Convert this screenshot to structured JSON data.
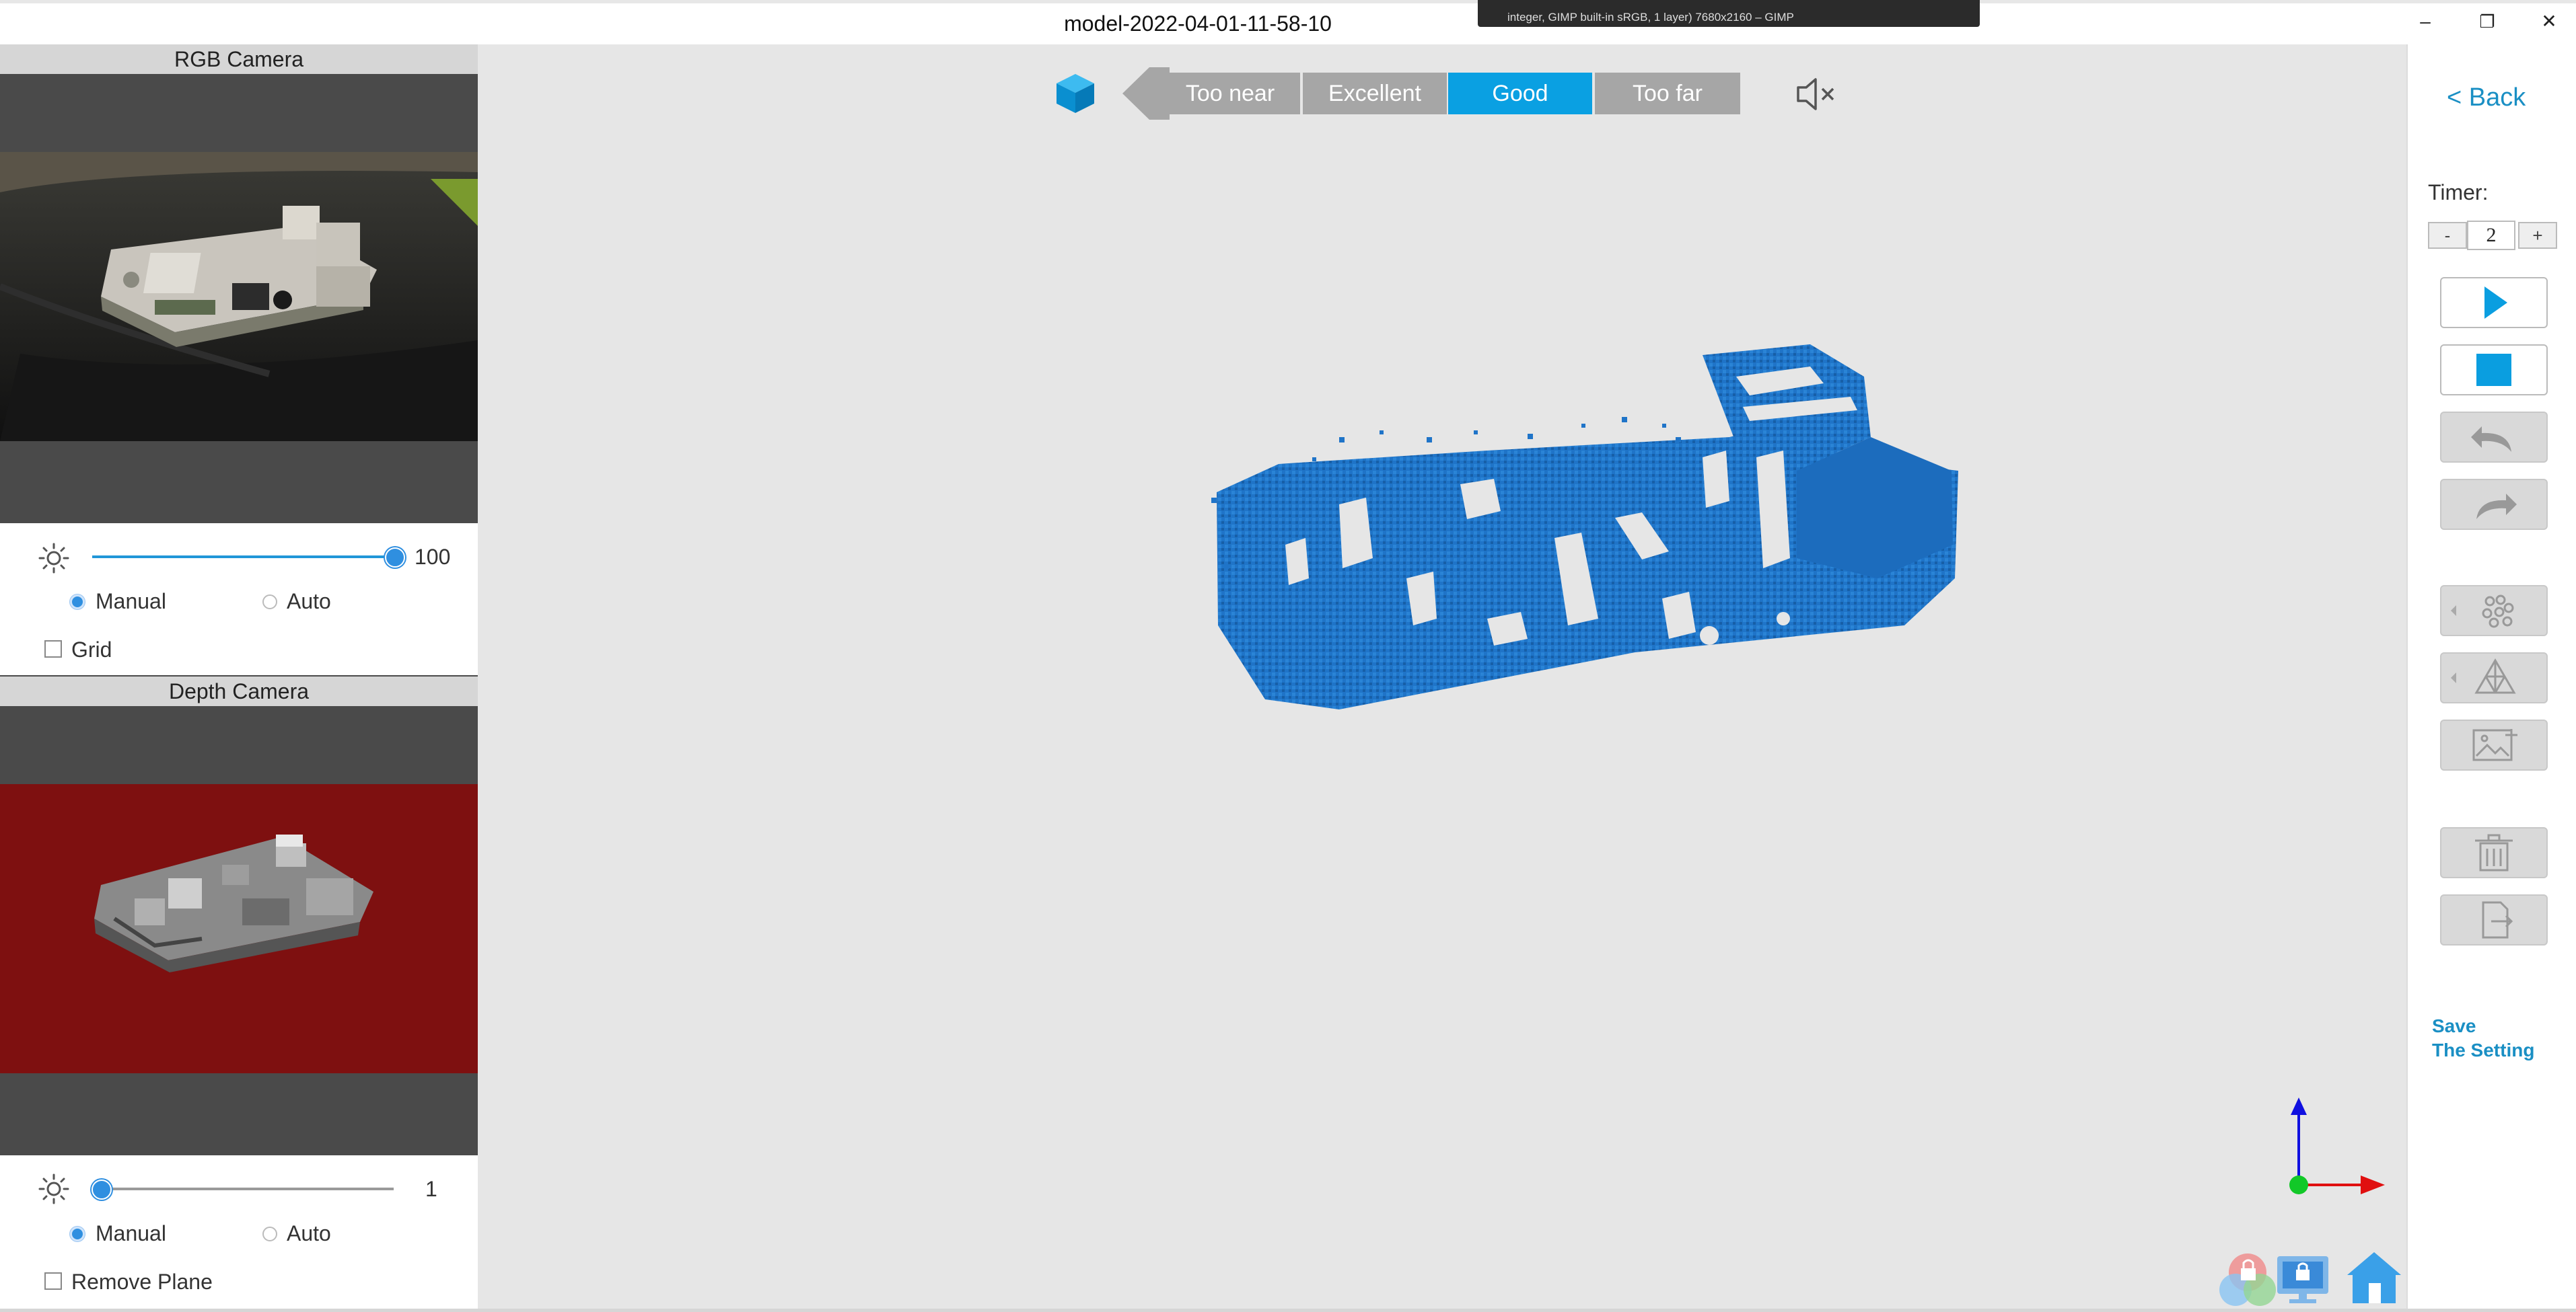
{
  "window": {
    "title": "model-2022-04-01-11-58-10",
    "tooltip_line1": "integer, GIMP built-in sRGB, 1 layer) 7680x2160 – GIMP",
    "minimize_label": "–",
    "maximize_label": "❐",
    "close_label": "✕"
  },
  "rgb_camera": {
    "header": "RGB Camera",
    "brightness_value": "100",
    "brightness_fraction": 1.0,
    "mode_manual": "Manual",
    "mode_auto": "Auto",
    "selected_mode": "Manual",
    "grid_label": "Grid",
    "grid_checked": false
  },
  "depth_camera": {
    "header": "Depth Camera",
    "value": "1",
    "value_fraction": 0.0,
    "mode_manual": "Manual",
    "mode_auto": "Auto",
    "selected_mode": "Manual",
    "remove_plane_label": "Remove Plane",
    "remove_plane_checked": false
  },
  "distance_bar": {
    "segments": [
      "Too near",
      "Excellent",
      "Good",
      "Too far"
    ],
    "active": "Good"
  },
  "right_panel": {
    "back_label": "< Back",
    "timer_label": "Timer:",
    "timer_minus": "-",
    "timer_value": "2",
    "timer_plus": "+",
    "save_line1": "Save",
    "save_line2": "The Setting"
  },
  "colors": {
    "accent": "#0aa0e2",
    "link": "#1a8fc4",
    "point_cloud": "#1f74c8",
    "depth_background": "#8c1010",
    "segment_inactive": "#a6a6a6"
  },
  "icons": {
    "brightness": "sun-icon",
    "cube": "cube-icon",
    "mute": "speaker-muted-icon",
    "play": "play-icon",
    "stop": "stop-icon",
    "undo": "undo-icon",
    "redo": "redo-icon",
    "cluster": "point-cluster-icon",
    "mesh": "mesh-icon",
    "texture": "image-add-icon",
    "delete": "trash-icon",
    "export": "export-icon",
    "axes": "axes-gizmo-icon"
  }
}
